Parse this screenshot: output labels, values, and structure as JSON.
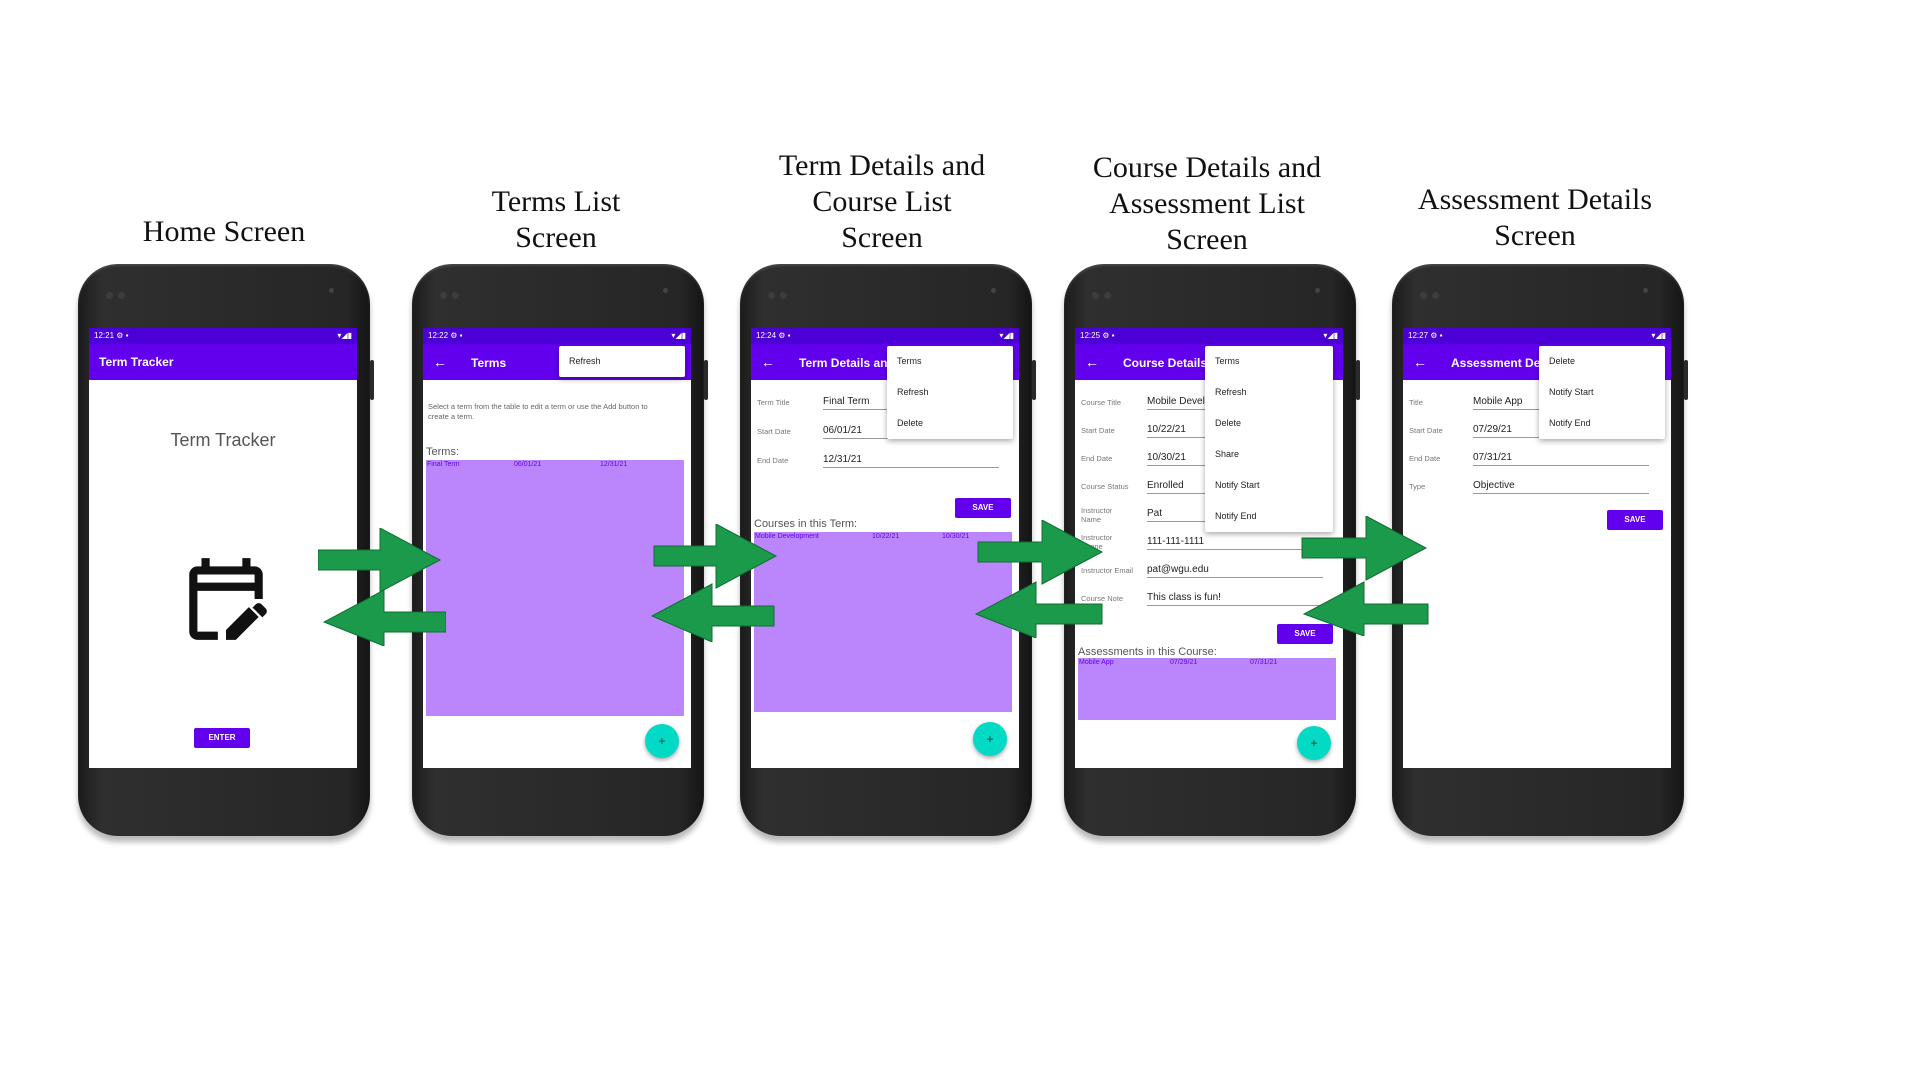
{
  "captions": {
    "home": [
      "Home Screen"
    ],
    "terms": [
      "Terms List",
      "Screen"
    ],
    "termdetails": [
      "Term Details and",
      "Course List",
      "Screen"
    ],
    "coursedetails": [
      "Course Details and",
      "Assessment List",
      "Screen"
    ],
    "assessment": [
      "Assessment Details",
      "Screen"
    ]
  },
  "colors": {
    "primary": "#6200ee",
    "status": "#4b00d6",
    "table": "#bb86fc",
    "fab": "#03dac5",
    "arrow": "#1a9a4a"
  },
  "home": {
    "time": "12:21",
    "app_title": "Term Tracker",
    "heading": "Term Tracker",
    "icon": "calendar-edit-icon",
    "enter_label": "ENTER"
  },
  "terms": {
    "time": "12:22",
    "title": "Terms",
    "menu": [
      "Refresh"
    ],
    "instructions": "Select a term from the table to edit a term or use the Add button to create a term.",
    "list_label": "Terms:",
    "rows": [
      {
        "title": "Final Term",
        "start": "06/01/21",
        "end": "12/31/21"
      }
    ],
    "fab": "+"
  },
  "termdetails": {
    "time": "12:24",
    "title": "Term Details and Course List",
    "menu": [
      "Terms",
      "Refresh",
      "Delete"
    ],
    "fields": [
      {
        "label": "Term Title",
        "value": "Final Term"
      },
      {
        "label": "Start Date",
        "value": "06/01/21"
      },
      {
        "label": "End Date",
        "value": "12/31/21"
      }
    ],
    "save_label": "SAVE",
    "list_label": "Courses in this Term:",
    "rows": [
      {
        "title": "Mobile Development",
        "start": "10/22/21",
        "end": "10/30/21"
      }
    ],
    "fab": "+"
  },
  "coursedetails": {
    "time": "12:25",
    "title": "Course Details and Assessment List",
    "menu": [
      "Terms",
      "Refresh",
      "Delete",
      "Share",
      "Notify Start",
      "Notify End"
    ],
    "fields": [
      {
        "label": "Course Title",
        "value": "Mobile Development"
      },
      {
        "label": "Start Date",
        "value": "10/22/21"
      },
      {
        "label": "End Date",
        "value": "10/30/21"
      },
      {
        "label": "Course Status",
        "value": "Enrolled"
      },
      {
        "label": "Instructor Name",
        "value": "Pat"
      },
      {
        "label": "Instructor Phone",
        "value": "111-111-1111"
      },
      {
        "label": "Instructor Email",
        "value": "pat@wgu.edu"
      },
      {
        "label": "Course Note",
        "value": "This class is fun!"
      }
    ],
    "save_label": "SAVE",
    "list_label": "Assessments in this Course:",
    "rows": [
      {
        "title": "Mobile App",
        "start": "07/29/21",
        "end": "07/31/21"
      }
    ],
    "fab": "+"
  },
  "assessment": {
    "time": "12:27",
    "title": "Assessment Details",
    "menu": [
      "Delete",
      "Notify Start",
      "Notify End"
    ],
    "fields": [
      {
        "label": "Title",
        "value": "Mobile App"
      },
      {
        "label": "Start Date",
        "value": "07/29/21"
      },
      {
        "label": "End Date",
        "value": "07/31/21"
      },
      {
        "label": "Type",
        "value": "Objective"
      }
    ],
    "save_label": "SAVE"
  }
}
